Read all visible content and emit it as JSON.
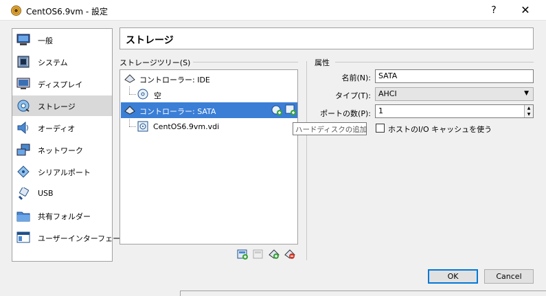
{
  "window": {
    "title": "CentOS6.9vm - 設定",
    "help_label": "?",
    "close_label": "✕"
  },
  "sidebar": {
    "items": [
      {
        "label": "一般",
        "icon": "general-icon",
        "selected": false
      },
      {
        "label": "システム",
        "icon": "system-icon",
        "selected": false
      },
      {
        "label": "ディスプレイ",
        "icon": "display-icon",
        "selected": false
      },
      {
        "label": "ストレージ",
        "icon": "storage-icon",
        "selected": true
      },
      {
        "label": "オーディオ",
        "icon": "audio-icon",
        "selected": false
      },
      {
        "label": "ネットワーク",
        "icon": "network-icon",
        "selected": false
      },
      {
        "label": "シリアルポート",
        "icon": "serial-port-icon",
        "selected": false
      },
      {
        "label": "USB",
        "icon": "usb-icon",
        "selected": false
      },
      {
        "label": "共有フォルダー",
        "icon": "shared-folder-icon",
        "selected": false
      },
      {
        "label": "ユーザーインターフェース",
        "icon": "user-interface-icon",
        "selected": false
      }
    ]
  },
  "page": {
    "title": "ストレージ"
  },
  "storage_tree": {
    "group_label": "ストレージツリー(S)",
    "rows": [
      {
        "label": "コントローラー: IDE",
        "kind": "controller",
        "selected": false
      },
      {
        "label": "空",
        "kind": "optical",
        "selected": false
      },
      {
        "label": "コントローラー: SATA",
        "kind": "controller",
        "selected": true
      },
      {
        "label": "CentOS6.9vm.vdi",
        "kind": "disk",
        "selected": false
      }
    ],
    "tooltip": "ハードディスクの追加"
  },
  "attributes": {
    "group_label": "属性",
    "name_label": "名前(N):",
    "name_value": "SATA",
    "type_label": "タイプ(T):",
    "type_value": "AHCI",
    "port_label": "ポートの数(P):",
    "port_value": "1",
    "host_cache_label": "ホストのI/O キャッシュを使う",
    "host_cache_checked": false
  },
  "buttons": {
    "ok": "OK",
    "cancel": "Cancel"
  },
  "colors": {
    "selection": "#3a7ed6",
    "default_button_border": "#0078d7"
  }
}
